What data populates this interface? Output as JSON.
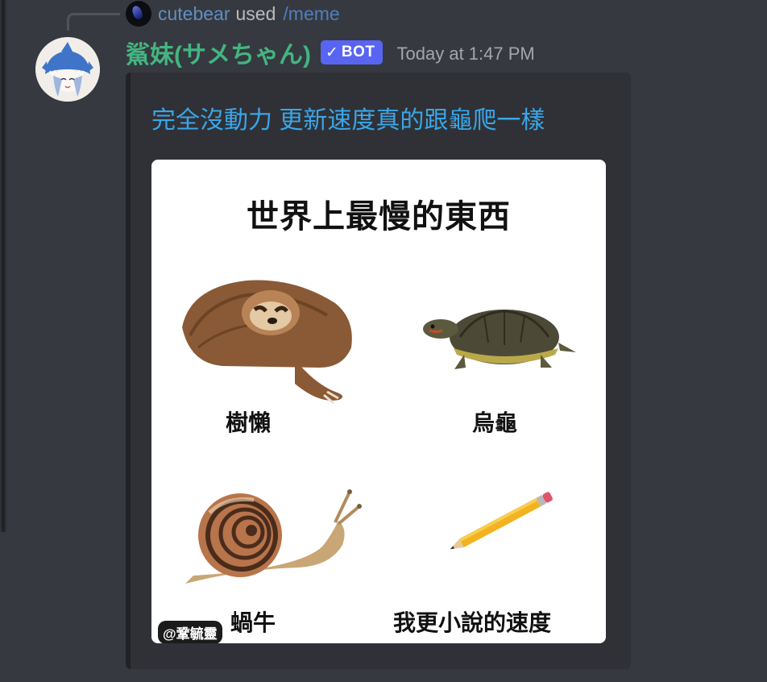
{
  "reply": {
    "username": "cutebear",
    "action": "used",
    "command": "/meme"
  },
  "message": {
    "bot_name": "鯊妹(サメちゃん)",
    "bot_tag": "BOT",
    "timestamp": "Today at 1:47 PM"
  },
  "embed": {
    "title": "完全沒動力 更新速度真的跟龜爬一樣",
    "image": {
      "title": "世界上最慢的東西",
      "cells": [
        {
          "label": "樹懶",
          "picture": "sloth"
        },
        {
          "label": "烏龜",
          "picture": "turtle"
        },
        {
          "label": "蝸牛",
          "picture": "snail"
        },
        {
          "label": "我更小說的速度",
          "picture": "pencil"
        }
      ],
      "watermark": "@鞏毓靈"
    }
  },
  "colors": {
    "background": "#36393f",
    "embed_background": "#2f3136",
    "bot_name": "#43b581",
    "bot_tag": "#5865f2",
    "link": "#3aa6e8",
    "reply_user": "#5d8fc4"
  },
  "icons": [
    "reply-avatar-icon",
    "bot-avatar-icon",
    "verified-check-icon"
  ]
}
